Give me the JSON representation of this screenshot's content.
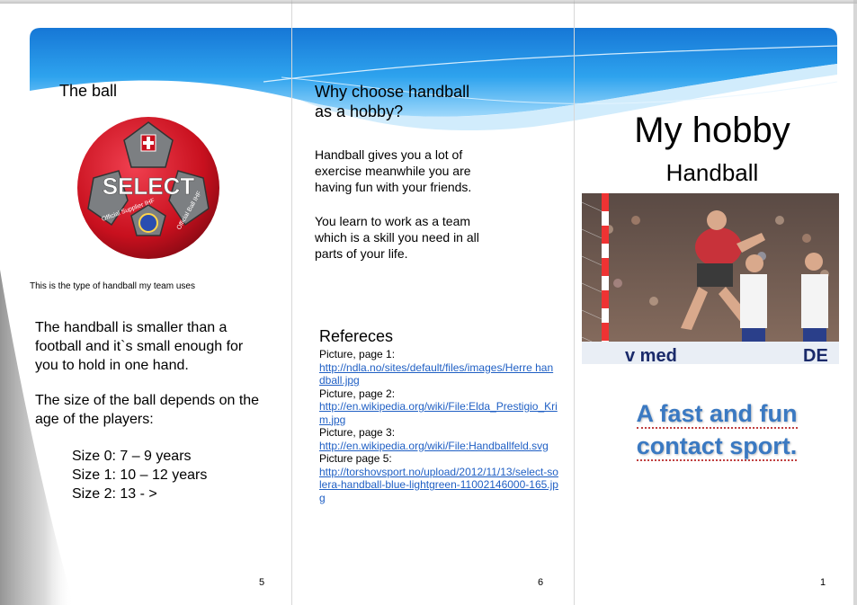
{
  "panel_left": {
    "title": "The ball",
    "image_caption": "This is the type of handball my team uses",
    "paragraph_1": "The handball is smaller than a football and it`s small enough for you to hold in one hand.",
    "paragraph_2": "The size of the ball depends on the age of the players:",
    "sizes": [
      "Size 0: 7 – 9 years",
      "Size 1: 10 – 12 years",
      "Size 2: 13 - >"
    ],
    "page_number": "5",
    "ball_text": "SELECT",
    "ball_side_left": "Official Supplier IHF",
    "ball_side_right": "Official Ball IHF"
  },
  "panel_middle": {
    "title_line1": "Why choose handball",
    "title_line2": "as a hobby?",
    "paragraph_1": "Handball gives you a lot of exercise meanwhile you are having fun with your friends.",
    "paragraph_2": "You learn to work as a team which is a skill you need in all parts of your life.",
    "references_title": "Refereces",
    "references": [
      {
        "label": "Picture, page 1:",
        "link": "http://ndla.no/sites/default/files/images/Herre handball.jpg"
      },
      {
        "label": "Picture, page 2:",
        "link": "http://en.wikipedia.org/wiki/File:Elda_Prestigio_Krim.jpg"
      },
      {
        "label": "Picture, page 3:",
        "link": "http://en.wikipedia.org/wiki/File:Handballfeld.svg"
      },
      {
        "label": "Picture page 5:",
        "link": "http://torshovsport.no/upload/2012/11/13/select-solera-handball-blue-lightgreen-11002146000-165.jpg"
      }
    ],
    "page_number": "6"
  },
  "panel_right": {
    "title": "My hobby",
    "subtitle": "Handball",
    "tagline_line1": "A fast and fun",
    "tagline_line2": "contact sport.",
    "photo_banner_text": "v med",
    "photo_banner_text_right": "DE",
    "page_number": "1"
  },
  "colors": {
    "band_blue": "#1e8fe0",
    "band_light": "#8fd0f8",
    "link_blue": "#1f5fc4",
    "tagline_blue": "#3a79c2",
    "ball_red": "#d81e2a",
    "ball_gray": "#7a7a7a"
  }
}
